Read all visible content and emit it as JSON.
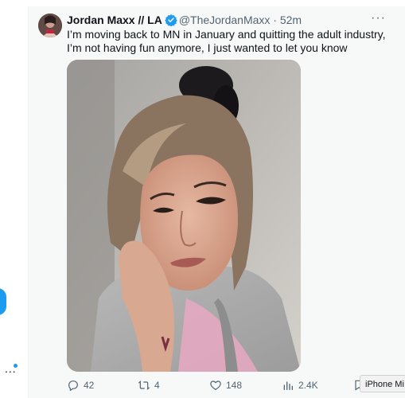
{
  "tweet": {
    "author_name": "Jordan Maxx // LA",
    "handle": "@TheJordanMaxx",
    "separator": "·",
    "time": "52m",
    "more_label": "···",
    "text": "I’m moving back to MN in January and quitting the adult industry, I’m not having fun anymore, I just wanted to let you know",
    "actions": {
      "replies": "42",
      "reposts": "4",
      "likes": "148",
      "views": "2.4K"
    }
  },
  "side": {
    "dots": "..."
  },
  "overlay": {
    "tooltip": "iPhone Mi"
  },
  "icons": {
    "verified": "verified-badge-icon",
    "reply": "reply-icon",
    "repost": "repost-icon",
    "like": "heart-icon",
    "views": "views-icon",
    "bookmark": "bookmark-icon"
  },
  "colors": {
    "accent": "#1d9bf0",
    "text": "#0f1419",
    "muted": "#536471",
    "card_bg": "#f7f9f9"
  }
}
